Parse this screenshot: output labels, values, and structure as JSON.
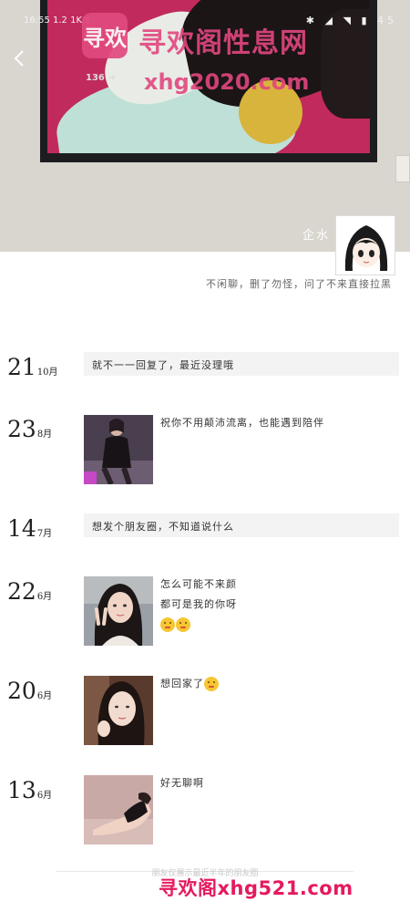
{
  "status_bar": {
    "time": "16:55",
    "speed": "1.2 1K/s",
    "battery": "45"
  },
  "watermark": {
    "logo_text": "寻欢",
    "mini": "136 ➜",
    "title": "寻欢阁性息网",
    "url": "xhg2020.com",
    "bottom": "寻欢阁xhg521.com"
  },
  "profile": {
    "nickname": "企水",
    "signature": "不闲聊，删了勿怪，问了不来直接拉黑"
  },
  "posts": [
    {
      "day": "21",
      "month": "10月",
      "type": "text",
      "text": "就不一一回复了，最近没理哦"
    },
    {
      "day": "23",
      "month": "8月",
      "type": "photo",
      "thumb": "woman-black-dress",
      "lines": [
        "祝你不用颠沛流离，也能遇到陪伴"
      ]
    },
    {
      "day": "14",
      "month": "7月",
      "type": "text",
      "text": "想发个朋友圈，不知道说什么"
    },
    {
      "day": "22",
      "month": "6月",
      "type": "photo",
      "thumb": "woman-peace-sign",
      "lines": [
        "怎么可能不来颜",
        "都可是我的你呀"
      ],
      "emoji_count": 2
    },
    {
      "day": "20",
      "month": "6月",
      "type": "photo",
      "thumb": "woman-selfie",
      "lines": [
        "想回家了"
      ],
      "emoji_count": 1
    },
    {
      "day": "13",
      "month": "6月",
      "type": "photo",
      "thumb": "woman-lying",
      "lines": [
        "好无聊啊"
      ]
    }
  ],
  "footer": {
    "text": "朋友仅展示最近半年的朋友圈"
  }
}
